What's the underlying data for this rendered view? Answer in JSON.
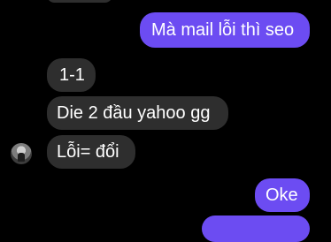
{
  "messages": [
    {
      "side": "out",
      "text": "Mà mail lỗi thì seo"
    },
    {
      "side": "in",
      "text": "1-1"
    },
    {
      "side": "in",
      "text": "Die 2 đầu yahoo gg"
    },
    {
      "side": "in",
      "text": "Lỗi= đổi"
    },
    {
      "side": "out",
      "text": "Oke"
    },
    {
      "side": "out",
      "text": ""
    }
  ],
  "colors": {
    "outgoing": "#6c4cf2",
    "incoming": "#2e2e2e",
    "background": "#000000"
  }
}
